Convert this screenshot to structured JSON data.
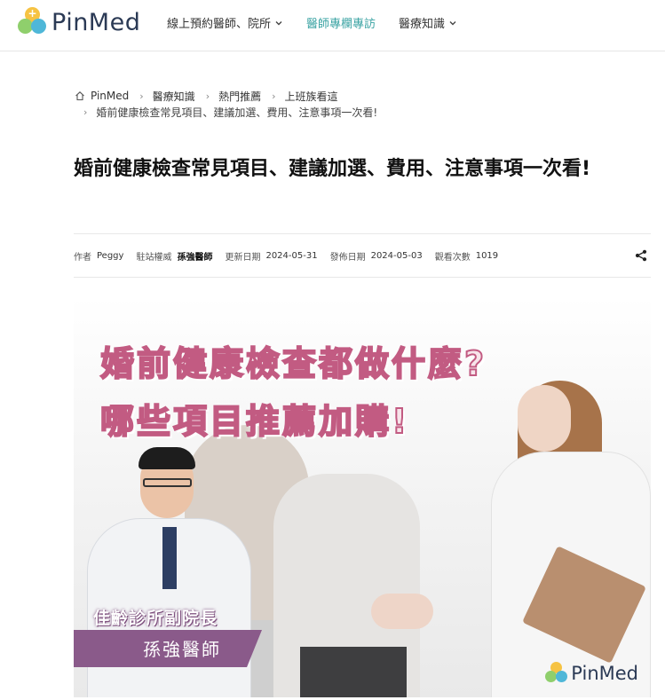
{
  "brand": {
    "name": "PinMed"
  },
  "nav": {
    "items": [
      {
        "label": "線上預約醫師、院所",
        "has_dropdown": true,
        "active": false
      },
      {
        "label": "醫師專欄專訪",
        "has_dropdown": false,
        "active": true
      },
      {
        "label": "醫療知識",
        "has_dropdown": true,
        "active": false
      }
    ]
  },
  "breadcrumb": {
    "home": "PinMed",
    "items": [
      "醫療知識",
      "熱門推薦",
      "上班族看這"
    ],
    "current": "婚前健康檢查常見項目、建議加選、費用、注意事項一次看!"
  },
  "article": {
    "title": "婚前健康檢查常見項目、建議加選、費用、注意事項一次看!",
    "meta": {
      "author_label": "作者",
      "author": "Peggy",
      "authority_label": "駐站權威",
      "authority": "孫強醫師",
      "updated_label": "更新日期",
      "updated": "2024-05-31",
      "published_label": "發佈日期",
      "published": "2024-05-03",
      "views_label": "觀看次數",
      "views": "1019"
    }
  },
  "hero": {
    "headline_1": "婚前健康檢查都做什麼?",
    "headline_2": "哪些項目推薦加購!",
    "doctor_role": "佳齡診所副院長",
    "doctor_name": "孫強醫師",
    "watermark": "PinMed"
  },
  "colors": {
    "nav_active": "#3aa3a3",
    "headline_stroke": "#c25b82",
    "name_band": "#8a5a8a"
  }
}
